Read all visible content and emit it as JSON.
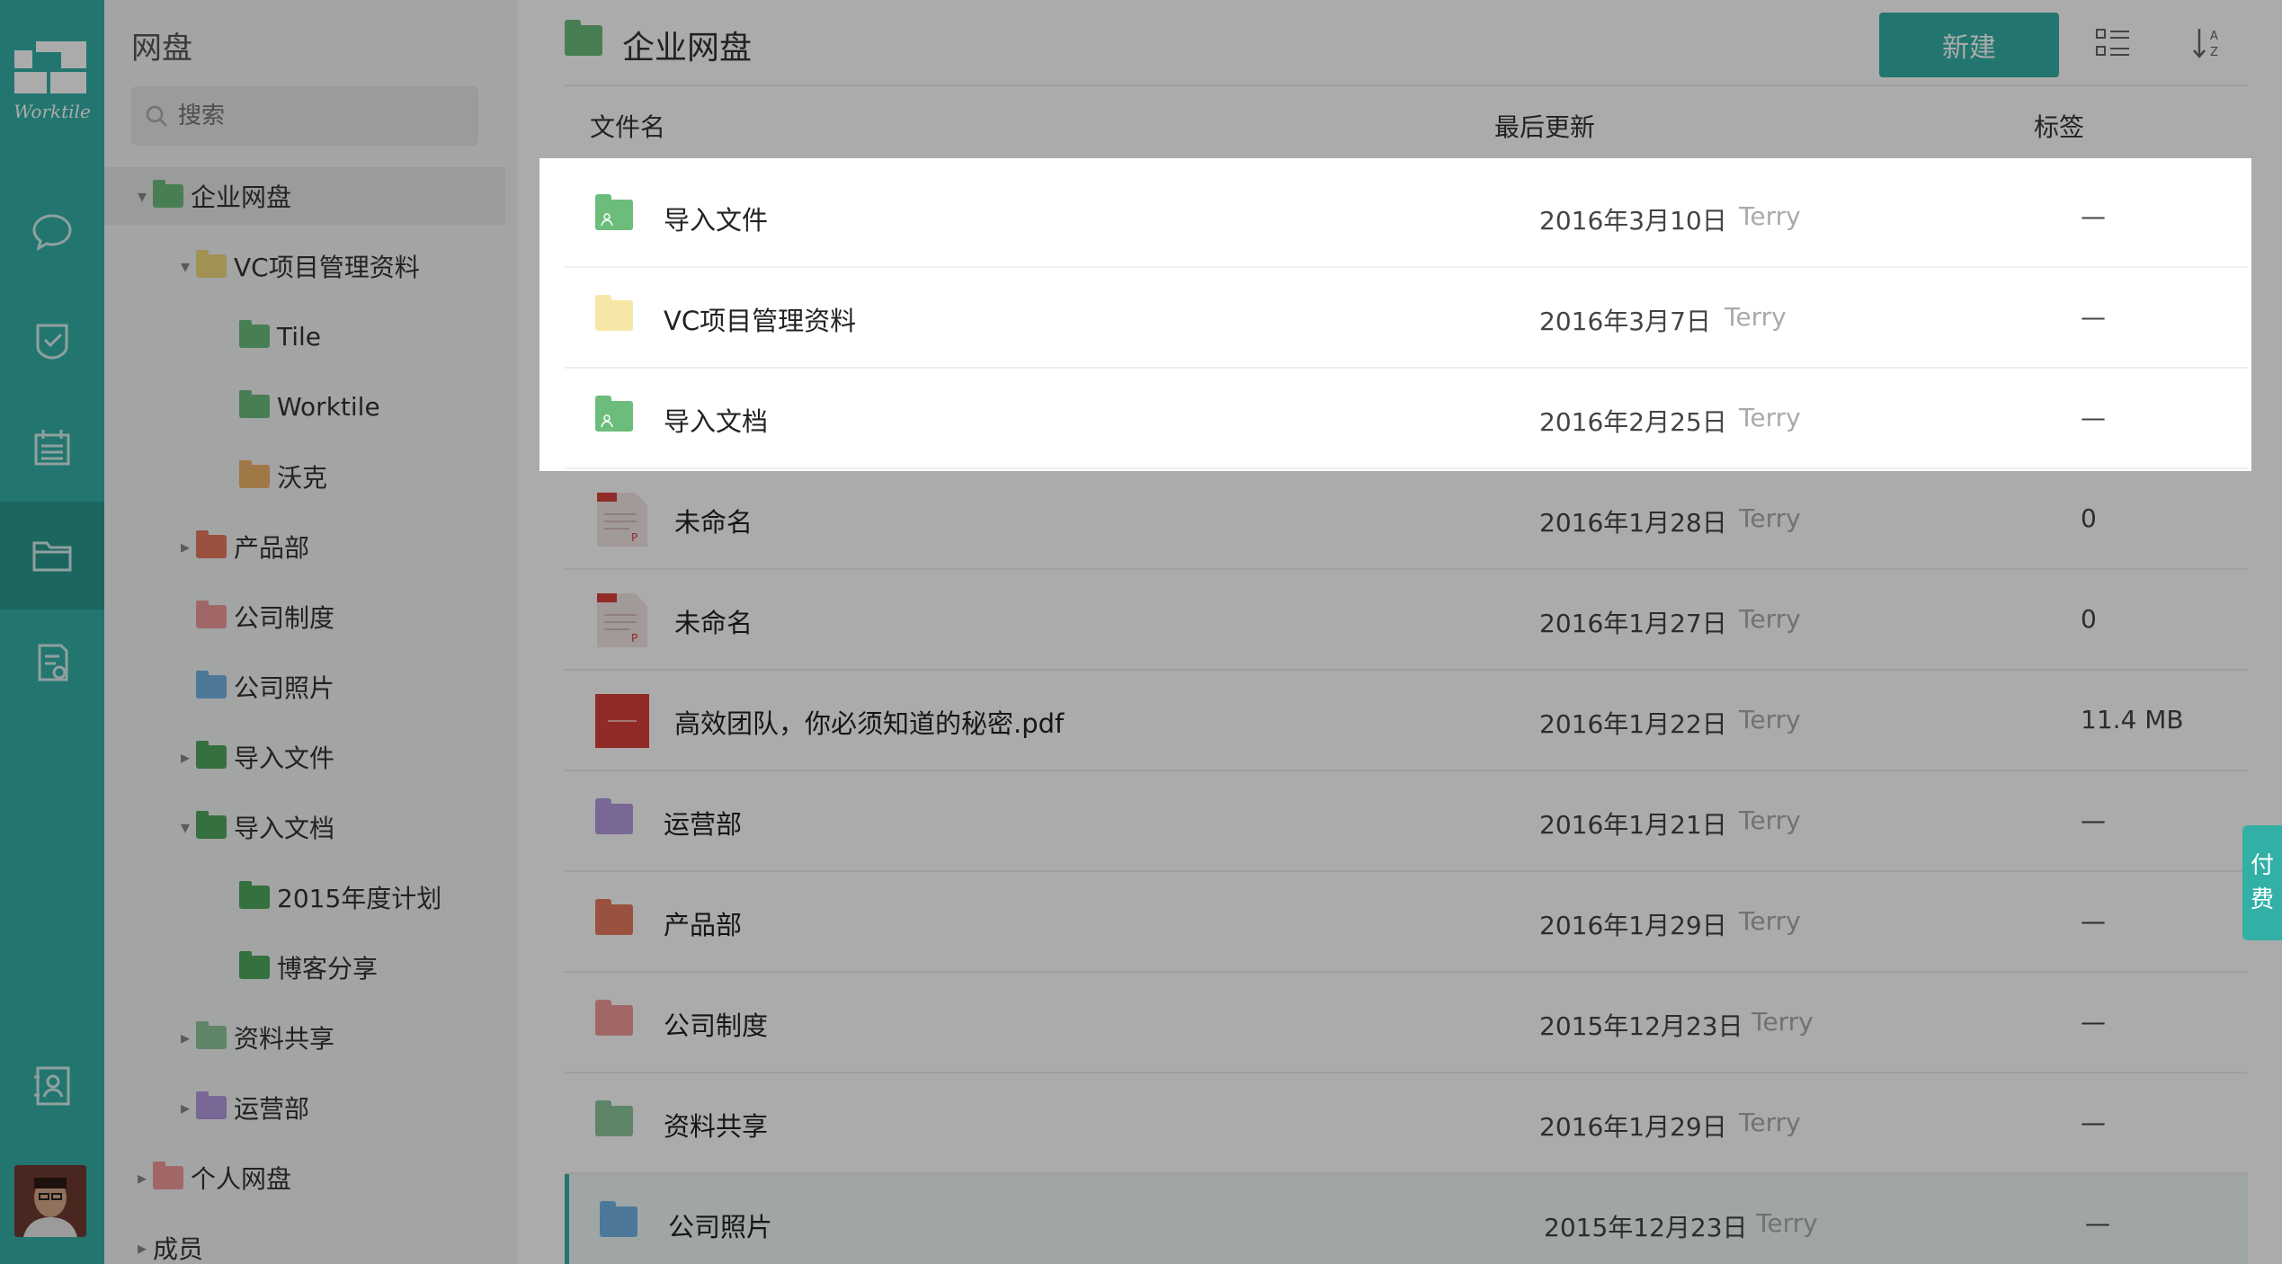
{
  "rail": {
    "logo_text": "Worktile",
    "items": [
      {
        "name": "chat-icon"
      },
      {
        "name": "task-icon"
      },
      {
        "name": "calendar-icon"
      },
      {
        "name": "drive-icon",
        "active": true
      },
      {
        "name": "report-icon"
      },
      {
        "name": "contacts-icon"
      }
    ]
  },
  "sidebar": {
    "title": "网盘",
    "search_placeholder": "搜索",
    "tree": [
      {
        "label": "企业网盘",
        "color": "#6cbd7c",
        "depth": 0,
        "caret": "down",
        "selected": true
      },
      {
        "label": "VC项目管理资料",
        "color": "#f2d97f",
        "depth": 1,
        "caret": "down"
      },
      {
        "label": "Tile",
        "color": "#6cbd7c",
        "depth": 2
      },
      {
        "label": "Worktile",
        "color": "#6cbd7c",
        "depth": 2
      },
      {
        "label": "沃克",
        "color": "#efb46b",
        "depth": 2
      },
      {
        "label": "产品部",
        "color": "#e8795f",
        "depth": 1,
        "caret": "right"
      },
      {
        "label": "公司制度",
        "color": "#f19a9a",
        "depth": 1
      },
      {
        "label": "公司照片",
        "color": "#74b3e6",
        "depth": 1
      },
      {
        "label": "导入文件",
        "color": "#4fa85e",
        "depth": 1,
        "caret": "right",
        "shared": true
      },
      {
        "label": "导入文档",
        "color": "#4fa85e",
        "depth": 1,
        "caret": "down",
        "shared": true
      },
      {
        "label": "2015年度计划",
        "color": "#4fa85e",
        "depth": 2,
        "shared": true
      },
      {
        "label": "博客分享",
        "color": "#4fa85e",
        "depth": 2,
        "shared": true
      },
      {
        "label": "资料共享",
        "color": "#8dc69a",
        "depth": 1,
        "caret": "right"
      },
      {
        "label": "运营部",
        "color": "#b59ae0",
        "depth": 1,
        "caret": "right"
      },
      {
        "label": "个人网盘",
        "color": "#f19a9a",
        "depth": 0,
        "caret": "right"
      },
      {
        "label": "成员",
        "color": "",
        "depth": 0,
        "caret": "right"
      }
    ]
  },
  "main": {
    "title": "企业网盘",
    "new_button": "新建",
    "columns": {
      "name": "文件名",
      "updated": "最后更新",
      "tag": "标签"
    },
    "rows": [
      {
        "type": "folder",
        "color": "#6cbd7c",
        "shared": true,
        "name": "导入文件",
        "date": "2016年3月10日",
        "user": "Terry",
        "tag": "—"
      },
      {
        "type": "folder",
        "color": "#f7e7a6",
        "name": "VC项目管理资料",
        "date": "2016年3月7日",
        "user": "Terry",
        "tag": "—"
      },
      {
        "type": "folder",
        "color": "#6cbd7c",
        "shared": true,
        "name": "导入文档",
        "date": "2016年2月25日",
        "user": "Terry",
        "tag": "—"
      },
      {
        "type": "doc",
        "name": "未命名",
        "date": "2016年1月28日",
        "user": "Terry",
        "tag": "0"
      },
      {
        "type": "doc",
        "name": "未命名",
        "date": "2016年1月27日",
        "user": "Terry",
        "tag": "0"
      },
      {
        "type": "pdf",
        "name": "高效团队，你必须知道的秘密.pdf",
        "date": "2016年1月22日",
        "user": "Terry",
        "tag": "11.4 MB"
      },
      {
        "type": "folder",
        "color": "#b59ae0",
        "name": "运营部",
        "date": "2016年1月21日",
        "user": "Terry",
        "tag": "—"
      },
      {
        "type": "folder",
        "color": "#e8795f",
        "name": "产品部",
        "date": "2016年1月29日",
        "user": "Terry",
        "tag": "—"
      },
      {
        "type": "folder",
        "color": "#f19a9a",
        "name": "公司制度",
        "date": "2015年12月23日",
        "user": "Terry",
        "tag": "—"
      },
      {
        "type": "folder",
        "color": "#8dc69a",
        "name": "资料共享",
        "date": "2016年1月29日",
        "user": "Terry",
        "tag": "—"
      },
      {
        "type": "folder",
        "color": "#74b3e6",
        "name": "公司照片",
        "date": "2015年12月23日",
        "user": "Terry",
        "tag": "—",
        "current": true
      }
    ]
  },
  "pay_tab": {
    "line1": "付",
    "line2": "费"
  },
  "colors": {
    "accent": "#33b0a6"
  }
}
